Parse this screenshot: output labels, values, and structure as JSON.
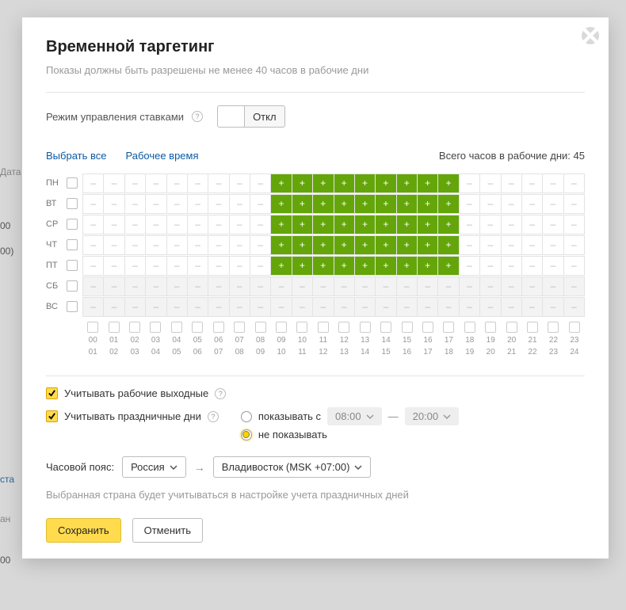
{
  "title": "Временной таргетинг",
  "subtitle": "Показы должны быть разрешены не менее 40 часов в рабочие дни",
  "bid_mode_label": "Режим управления ставками",
  "toggle_on_label": "",
  "toggle_off_label": "Откл",
  "select_all": "Выбрать все",
  "work_hours": "Рабочее время",
  "total_label": "Всего часов в рабочие дни:",
  "total_value": "45",
  "days": [
    "ПН",
    "ВТ",
    "СР",
    "ЧТ",
    "ПТ",
    "СБ",
    "ВС"
  ],
  "schedule": [
    [
      0,
      0,
      0,
      0,
      0,
      0,
      0,
      0,
      0,
      1,
      1,
      1,
      1,
      1,
      1,
      1,
      1,
      1,
      0,
      0,
      0,
      0,
      0,
      0
    ],
    [
      0,
      0,
      0,
      0,
      0,
      0,
      0,
      0,
      0,
      1,
      1,
      1,
      1,
      1,
      1,
      1,
      1,
      1,
      0,
      0,
      0,
      0,
      0,
      0
    ],
    [
      0,
      0,
      0,
      0,
      0,
      0,
      0,
      0,
      0,
      1,
      1,
      1,
      1,
      1,
      1,
      1,
      1,
      1,
      0,
      0,
      0,
      0,
      0,
      0
    ],
    [
      0,
      0,
      0,
      0,
      0,
      0,
      0,
      0,
      0,
      1,
      1,
      1,
      1,
      1,
      1,
      1,
      1,
      1,
      0,
      0,
      0,
      0,
      0,
      0
    ],
    [
      0,
      0,
      0,
      0,
      0,
      0,
      0,
      0,
      0,
      1,
      1,
      1,
      1,
      1,
      1,
      1,
      1,
      1,
      0,
      0,
      0,
      0,
      0,
      0
    ],
    [
      2,
      2,
      2,
      2,
      2,
      2,
      2,
      2,
      2,
      2,
      2,
      2,
      2,
      2,
      2,
      2,
      2,
      2,
      2,
      2,
      2,
      2,
      2,
      2
    ],
    [
      2,
      2,
      2,
      2,
      2,
      2,
      2,
      2,
      2,
      2,
      2,
      2,
      2,
      2,
      2,
      2,
      2,
      2,
      2,
      2,
      2,
      2,
      2,
      2
    ]
  ],
  "hour_top": [
    "00",
    "01",
    "02",
    "03",
    "04",
    "05",
    "06",
    "07",
    "08",
    "09",
    "10",
    "11",
    "12",
    "13",
    "14",
    "15",
    "16",
    "17",
    "18",
    "19",
    "20",
    "21",
    "22",
    "23"
  ],
  "hour_bot": [
    "01",
    "02",
    "03",
    "04",
    "05",
    "06",
    "07",
    "08",
    "09",
    "10",
    "11",
    "12",
    "13",
    "14",
    "15",
    "16",
    "17",
    "18",
    "19",
    "20",
    "21",
    "22",
    "23",
    "24"
  ],
  "consider_work_weekends": "Учитывать рабочие выходные",
  "consider_holidays": "Учитывать праздничные дни",
  "show_from_label": "показывать с",
  "show_from_time": "08:00",
  "dash": "—",
  "show_to_time": "20:00",
  "dont_show_label": "не показывать",
  "timezone_label": "Часовой пояс:",
  "country_value": "Россия",
  "arrow_between": "→",
  "city_value": "Владивосток (MSK +07:00)",
  "country_note": "Выбранная страна будет учитываться в настройке учета праздничных дней",
  "save": "Сохранить",
  "cancel": "Отменить",
  "bg": {
    "a": "Дата",
    "b": "00",
    "c": "00)",
    "d": "ста",
    "e": "ан",
    "f": "00"
  }
}
